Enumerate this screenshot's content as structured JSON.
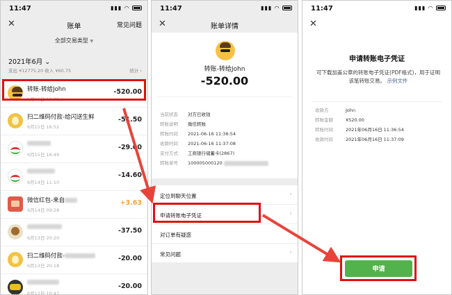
{
  "status": {
    "time": "11:47",
    "signal": "▮▮▮"
  },
  "screen1": {
    "title": "账单",
    "right": "常见问题",
    "filter": "全部交易类型",
    "month": "2021年6月",
    "summary": "支出 ¥12775.20  收入 ¥60.75",
    "stats": "统计",
    "rows": [
      {
        "title": "转账-转给John",
        "date": "6月16日 11:36",
        "amount": "-520.00",
        "icon": "avatar-john-icon"
      },
      {
        "title": "扫二维码付款-给闪送生鲜",
        "date": "6月15日 16:52",
        "amount": "-51.50",
        "icon": "coin-icon"
      },
      {
        "title": "",
        "date": "6月15日 16:49",
        "amount": "-29.00",
        "icon": "bank-icon"
      },
      {
        "title": "",
        "date": "6月14日 11:10",
        "amount": "-14.60",
        "icon": "bank-icon"
      },
      {
        "title": "微信红包-来自",
        "date": "6月14日 09:28",
        "amount": "+3.63",
        "icon": "red-packet-icon"
      },
      {
        "title": "",
        "date": "6月13日 20:20",
        "amount": "-37.50",
        "icon": "dog-icon"
      },
      {
        "title": "扫二维码付款-",
        "date": "6月13日 20:18",
        "amount": "-20.00",
        "icon": "coin-icon"
      },
      {
        "title": "",
        "date": "6月12日 10:42",
        "amount": "-20.00",
        "icon": "game-icon"
      }
    ]
  },
  "screen2": {
    "title": "账单详情",
    "name": "转账-转给John",
    "amount": "-520.00",
    "details": [
      {
        "k": "当前状态",
        "v": "对方已收钱"
      },
      {
        "k": "转账说明",
        "v": "微信转账"
      },
      {
        "k": "转账时间",
        "v": "2021-06-16 11:36:54"
      },
      {
        "k": "收款时间",
        "v": "2021-06-16 11:37:08"
      },
      {
        "k": "支付方式",
        "v": "工商银行储蓄卡(2867)"
      },
      {
        "k": "转账单号",
        "v": "100005000120"
      }
    ],
    "menu": [
      "定位到聊天位置",
      "申请转账电子凭证",
      "对订单有疑惑",
      "常见问题"
    ]
  },
  "screen3": {
    "title": "申请转账电子凭证",
    "desc": "可下载加盖公章的转账电子凭证(PDF格式)，用于证明该笔转账交易。",
    "link": "示例文件",
    "details": [
      {
        "k": "收款方",
        "v": "John"
      },
      {
        "k": "转账金额",
        "v": "¥520.00"
      },
      {
        "k": "转账时间",
        "v": "2021年06月16日 11:36:54"
      },
      {
        "k": "收款时间",
        "v": "2021年06月16日 11:37:09"
      }
    ],
    "button": "申请"
  },
  "colors": {
    "highlight": "#e0100e",
    "arrow": "#e8433a",
    "button": "#52b24b",
    "income": "#f0a23a"
  }
}
